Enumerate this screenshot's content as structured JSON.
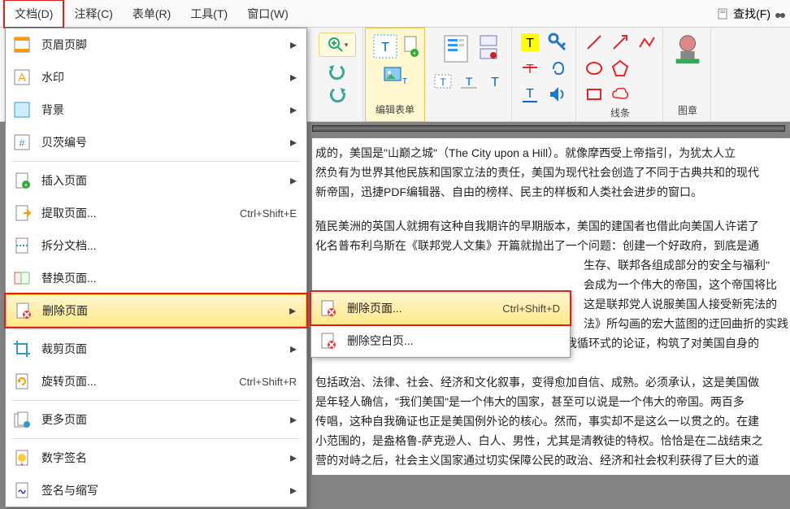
{
  "menubar": {
    "items": [
      "文档(D)",
      "注释(C)",
      "表单(R)",
      "工具(T)",
      "窗口(W)"
    ],
    "find": "查找(F)"
  },
  "toolbar": {
    "edit_form": "编辑表单",
    "lines": "线条",
    "stamp": "图章"
  },
  "menu": {
    "header_footer": "页眉页脚",
    "watermark": "水印",
    "background": "背景",
    "bates": "贝茨编号",
    "insert_page": "插入页面",
    "extract_page": "提取页面...",
    "extract_shortcut": "Ctrl+Shift+E",
    "split_doc": "拆分文档...",
    "replace_page": "替换页面...",
    "delete_page": "删除页面",
    "crop_page": "裁剪页面",
    "rotate_page": "旋转页面...",
    "rotate_shortcut": "Ctrl+Shift+R",
    "more_pages": "更多页面",
    "digital_sign": "数字签名",
    "sign_abbrev": "签名与缩写"
  },
  "submenu": {
    "delete_page": "删除页面...",
    "delete_shortcut": "Ctrl+Shift+D",
    "delete_blank": "删除空白页..."
  },
  "content": {
    "p1": "成的，美国是\"山巅之城\"（The City upon a Hill）。就像摩西受上帝指引，为犹太人立",
    "p2": "然负有为世界其他民族和国家立法的责任，美国为现代社会创造了不同于古典共和的现代",
    "p3": "新帝国，迅捷PDF编辑器、自由的榜样、民主的样板和人类社会进步的窗口。",
    "p4": "殖民美洲的英国人就拥有这种自我期许的早期版本，美国的建国者也借此向美国人许诺了",
    "p5": "化名普布利乌斯在《联邦党人文集》开篇就抛出了一个问题：创建一个好政府，到底是通",
    "p6": "生存、联邦各组成部分的安全与福利\"",
    "p7": "会成为一个伟大的帝国，这个帝国将比",
    "p8": "这是联邦党人说服美国人接受新宪法的",
    "p9": "法》所勾画的宏大蓝图的迂回曲折的实践",
    "p10": "国学者和政治家正是借助这种叙事，通过不断的自我循环式的论证，构筑了对美国自身的",
    "p11": "包括政治、法律、社会、经济和文化叙事，变得愈加自信、成熟。必须承认，这是美国做",
    "p12": "是年轻人确信，\"我们美国\"是一个伟大的国家，甚至可以说是一个伟大的帝国。两百多",
    "p13": "传唱，这种自我确证也正是美国例外论的核心。然而，事实却不是这么一以贯之的。在建",
    "p14": "小范围的，是盎格鲁-萨克逊人、白人、男性，尤其是清教徒的特权。恰恰是在二战结束之",
    "p15": "营的对峙之后，社会主义国家通过切实保障公民的政治、经济和社会权利获得了巨大的道"
  }
}
